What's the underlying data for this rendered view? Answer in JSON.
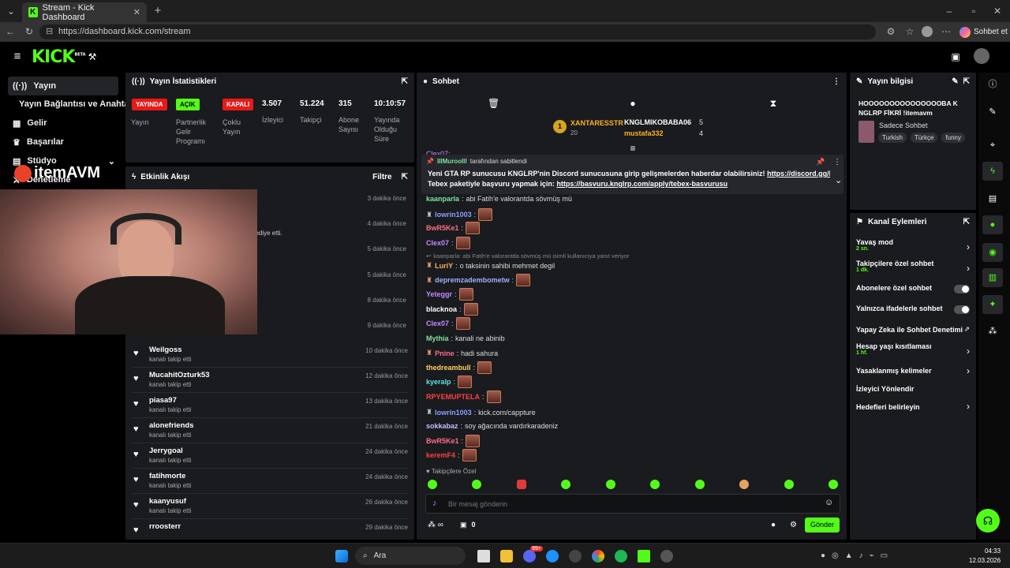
{
  "browser": {
    "tab_title": "Stream - Kick Dashboard",
    "url": "https://dashboard.kick.com/stream",
    "profile_label": "Sohbet et"
  },
  "app": {
    "logo": "KICK",
    "beta": "BETA"
  },
  "sidebar": {
    "items": [
      {
        "label": "Yayın"
      },
      {
        "label": "Yayın Bağlantısı ve Anahtarı"
      },
      {
        "label": "Gelir"
      },
      {
        "label": "Başarılar"
      },
      {
        "label": "Stüdyo"
      },
      {
        "label": "Denetleme"
      }
    ]
  },
  "overlay_logo": "itemAVM",
  "stats": {
    "title": "Yayın İstatistikleri",
    "badges": [
      {
        "label": "YAYINDA",
        "caption": "Yayın"
      },
      {
        "label": "AÇIK",
        "caption": "Partnerlik Gelir Programı"
      },
      {
        "label": "KAPALI",
        "caption": "Çoklu Yayın"
      }
    ],
    "values": [
      {
        "value": "3.507",
        "caption": "İzleyici"
      },
      {
        "value": "51.224",
        "caption": "Takipçi"
      },
      {
        "value": "315",
        "caption": "Abone Sayısı"
      },
      {
        "value": "10:10:57",
        "caption": "Yayında Olduğu Süre"
      }
    ]
  },
  "activity": {
    "title": "Etkinlik Akışı",
    "filter": "Filtre",
    "partial_text": "hediye etti.",
    "hidden_times": [
      "3 dakika önce",
      "4 dakika önce",
      "5 dakika önce",
      "5 dakika önce",
      "8 dakika önce",
      "9 dakika önce"
    ],
    "events": [
      {
        "name": "Weilgoss",
        "sub": "kanalı takip etti",
        "time": "10 dakika önce"
      },
      {
        "name": "MucahitOzturk53",
        "sub": "kanalı takip etti",
        "time": "12 dakika önce"
      },
      {
        "name": "piasa97",
        "sub": "kanalı takip etti",
        "time": "13 dakika önce"
      },
      {
        "name": "alonefriends",
        "sub": "kanalı takip etti",
        "time": "21 dakika önce"
      },
      {
        "name": "Jerrygoal",
        "sub": "kanalı takip etti",
        "time": "24 dakika önce"
      },
      {
        "name": "fatihmorte",
        "sub": "kanalı takip etti",
        "time": "24 dakika önce"
      },
      {
        "name": "kaanyusuf",
        "sub": "kanalı takip etti",
        "time": "26 dakika önce"
      },
      {
        "name": "rroosterr",
        "sub": "",
        "time": "29 dakika önce"
      }
    ]
  },
  "chat": {
    "title": "Sohbet",
    "leader1": {
      "name": "XANTARESSTR",
      "count": "20"
    },
    "leader2": {
      "name": "KNGLMIKOBABA06",
      "count": "5"
    },
    "leader3": {
      "name": "mustafa332",
      "count": "4"
    },
    "pinned_partial": "Clex07:",
    "pinned_by_user": "IllMuroolll",
    "pinned_by_text": "tarafından sabitlendi",
    "pinned_line1": "Yeni GTA RP sunucusu KNGLRP'nin Discord sunucusuna girip gelişmelerden haberdar olabilirsiniz!",
    "pinned_link1": "https://discord.gg/knglrp",
    "pinned_line2": "Tebex paketiyle başvuru yapmak için:",
    "pinned_link2": "https://basvuru.knglrp.com/apply/tebex-basvurusu",
    "messages": [
      {
        "user": "kaanparla",
        "text": "abi Fatih'e valorantda sövmüş mü",
        "color": "#7fe0a0"
      },
      {
        "user": "lowrin1003",
        "text": "",
        "color": "#8aa0ff"
      },
      {
        "user": "BwR5Ke1",
        "text": "",
        "color": "#ff6b8a"
      },
      {
        "user": "Clex07",
        "text": "",
        "color": "#c48aff"
      },
      {
        "user": "LuriY",
        "text": "o taksinin sahibi mehmet degil",
        "color": "#ffb060"
      },
      {
        "user": "depremzadembometw",
        "text": "",
        "color": "#a0b0ff"
      },
      {
        "user": "Yeteggr",
        "text": "",
        "color": "#c48aff"
      },
      {
        "user": "blacknoa",
        "text": "",
        "color": "#ffffff"
      },
      {
        "user": "Clex07",
        "text": "",
        "color": "#c48aff"
      },
      {
        "user": "Mythia",
        "text": "kanali ne abinib",
        "color": "#7fe0a0"
      },
      {
        "user": "Pnine",
        "text": "hadi sahura",
        "color": "#ff6b8a"
      },
      {
        "user": "thedreambull",
        "text": "",
        "color": "#ffd060"
      },
      {
        "user": "kyeralp",
        "text": "",
        "color": "#60e0e0"
      },
      {
        "user": "RPYEMUPTELA",
        "text": "",
        "color": "#ff4040"
      },
      {
        "user": "lowrin1003",
        "text": "kick.com/cappture",
        "color": "#8aa0ff"
      },
      {
        "user": "sokkabaz",
        "text": "soy ağacında vardırkaradeniz",
        "color": "#c0c0ff"
      },
      {
        "user": "BwR5Ke1",
        "text": "",
        "color": "#ff6b8a"
      },
      {
        "user": "keremF4",
        "text": "",
        "color": "#ff4040"
      }
    ],
    "reply_text": "kaanparla: abi Fatih'e valorantda sövmüş mü isimli kullanıcıya yanıt veriyor",
    "follower_only": "Takipçilere Özel",
    "input_placeholder": "Bir mesaj gönderin",
    "counter": "0",
    "send": "Gönder"
  },
  "stream_info": {
    "title": "Yayın bilgisi",
    "stream_title": "HOOOOOOOOOOOOOOOBA KNGLRP FİKRİ !itemavm",
    "category": "Sadece Sohbet",
    "tags": [
      "Turkish",
      "Türkçe",
      "funny"
    ]
  },
  "channel_actions": {
    "title": "Kanal Eylemleri",
    "items": [
      {
        "label": "Yavaş mod",
        "sub": "2 sn.",
        "control": "chevron"
      },
      {
        "label": "Takipçilere özel sohbet",
        "sub": "1 dk.",
        "control": "chevron"
      },
      {
        "label": "Abonelere özel sohbet",
        "sub": "",
        "control": "toggle"
      },
      {
        "label": "Yalnızca ifadelerle sohbet",
        "sub": "",
        "control": "toggle"
      },
      {
        "label": "Yapay Zeka ile Sohbet Denetimi",
        "sub": "",
        "control": "external"
      },
      {
        "label": "Hesap yaşı kısıtlaması",
        "sub": "1 hf.",
        "control": "chevron"
      },
      {
        "label": "Yasaklanmış kelimeler",
        "sub": "",
        "control": "chevron"
      },
      {
        "label": "İzleyici Yönlendir",
        "sub": "",
        "control": "none"
      },
      {
        "label": "Hedefleri belirleyin",
        "sub": "",
        "control": "chevron"
      }
    ]
  },
  "taskbar": {
    "search": "Ara",
    "time": "04:33",
    "date": "12.03.2026",
    "badge": "99+"
  },
  "colors": {
    "accent": "#53fc18",
    "panel": "#191b1f",
    "live_red": "#e91916"
  }
}
